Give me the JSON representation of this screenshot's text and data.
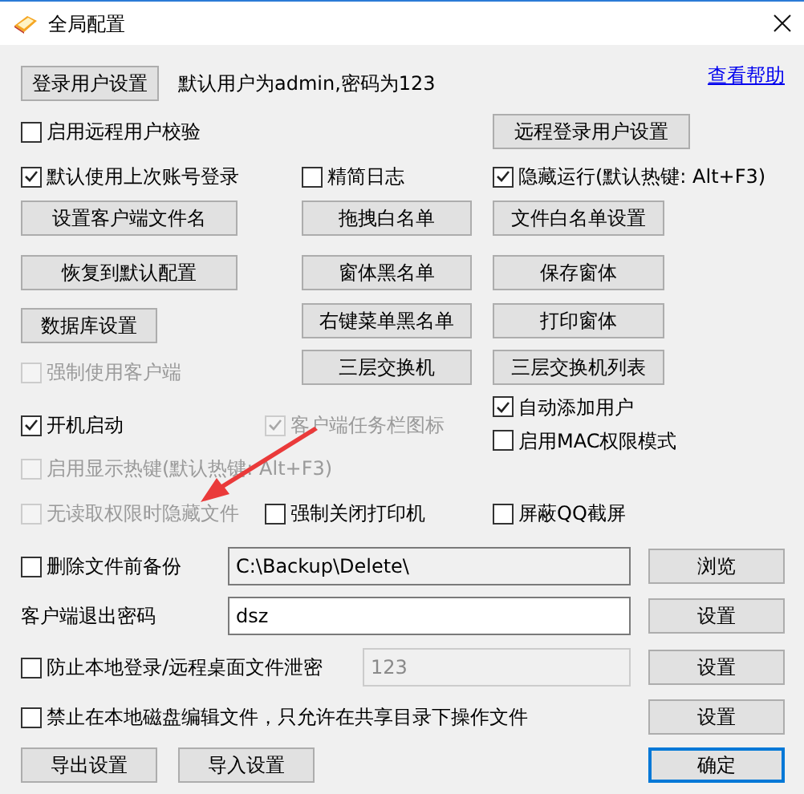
{
  "window": {
    "title": "全局配置"
  },
  "header": {
    "button": "登录用户设置",
    "note": "默认用户为admin,密码为123",
    "help_link": "查看帮助"
  },
  "rows": [
    {
      "items": [
        {
          "kind": "checkbox",
          "label": "启用远程用户校验",
          "checked": false,
          "disabled": false
        },
        {
          "kind": "button",
          "label": "远程登录用户设置"
        }
      ]
    },
    {
      "items": [
        {
          "kind": "checkbox",
          "label": "默认使用上次账号登录",
          "checked": true,
          "disabled": false
        },
        {
          "kind": "checkbox",
          "label": "精简日志",
          "checked": false,
          "disabled": false
        },
        {
          "kind": "checkbox",
          "label": "隐藏运行(默认热键: Alt+F3)",
          "checked": true,
          "disabled": false
        }
      ]
    },
    {
      "items": [
        {
          "kind": "button",
          "label": "设置客户端文件名"
        },
        {
          "kind": "button",
          "label": "拖拽白名单"
        },
        {
          "kind": "button",
          "label": "文件白名单设置"
        }
      ]
    },
    {
      "items": [
        {
          "kind": "button",
          "label": "恢复到默认配置"
        },
        {
          "kind": "button",
          "label": "窗体黑名单"
        },
        {
          "kind": "button",
          "label": "保存窗体"
        }
      ]
    },
    {
      "items": [
        {
          "kind": "button",
          "label": "数据库设置"
        },
        {
          "kind": "button",
          "label": "右键菜单黑名单"
        },
        {
          "kind": "button",
          "label": "打印窗体"
        }
      ]
    },
    {
      "items": [
        {
          "kind": "checkbox",
          "label": "强制使用客户端",
          "checked": false,
          "disabled": true
        },
        {
          "kind": "button",
          "label": "三层交换机"
        },
        {
          "kind": "button",
          "label": "三层交换机列表"
        }
      ]
    },
    {
      "items": [
        {
          "kind": "checkbox",
          "label": "开机启动",
          "checked": true,
          "disabled": false
        },
        {
          "kind": "checkbox",
          "label": "客户端任务栏图标",
          "checked": true,
          "disabled": true
        },
        {
          "kind": "checkbox",
          "label": "自动添加用户",
          "checked": true,
          "disabled": false
        },
        {
          "kind": "checkbox",
          "label": "启用MAC权限模式",
          "checked": false,
          "disabled": false
        }
      ]
    },
    {
      "items": [
        {
          "kind": "checkbox",
          "label": "启用显示热键(默认热键: Alt+F3)",
          "checked": false,
          "disabled": true
        }
      ]
    },
    {
      "items": [
        {
          "kind": "checkbox",
          "label": "无读取权限时隐藏文件",
          "checked": false,
          "disabled": true
        },
        {
          "kind": "checkbox",
          "label": "强制关闭打印机",
          "checked": false,
          "disabled": false
        },
        {
          "kind": "checkbox",
          "label": "屏蔽QQ截屏",
          "checked": false,
          "disabled": false
        }
      ]
    },
    {
      "items": [
        {
          "kind": "checkbox",
          "label": "删除文件前备份",
          "checked": false,
          "disabled": false
        },
        {
          "kind": "input",
          "value": "C:\\Backup\\Delete\\",
          "readonly": true,
          "disabled": false
        },
        {
          "kind": "button",
          "label": "浏览"
        }
      ]
    },
    {
      "items": [
        {
          "kind": "label",
          "label": "客户端退出密码"
        },
        {
          "kind": "input",
          "value": "dsz",
          "readonly": false,
          "disabled": false
        },
        {
          "kind": "button",
          "label": "设置"
        }
      ]
    },
    {
      "items": [
        {
          "kind": "checkbox",
          "label": "防止本地登录/远程桌面文件泄密",
          "checked": false,
          "disabled": false
        },
        {
          "kind": "input",
          "value": "123",
          "disabled": true
        },
        {
          "kind": "button",
          "label": "设置"
        }
      ]
    },
    {
      "items": [
        {
          "kind": "checkbox",
          "label": "禁止在本地磁盘编辑文件，只允许在共享目录下操作文件",
          "checked": false,
          "disabled": false
        },
        {
          "kind": "button",
          "label": "设置"
        }
      ]
    },
    {
      "items": [
        {
          "kind": "button",
          "label": "导出设置"
        },
        {
          "kind": "button",
          "label": "导入设置"
        },
        {
          "kind": "button",
          "label": "确定",
          "default": true
        }
      ]
    }
  ]
}
